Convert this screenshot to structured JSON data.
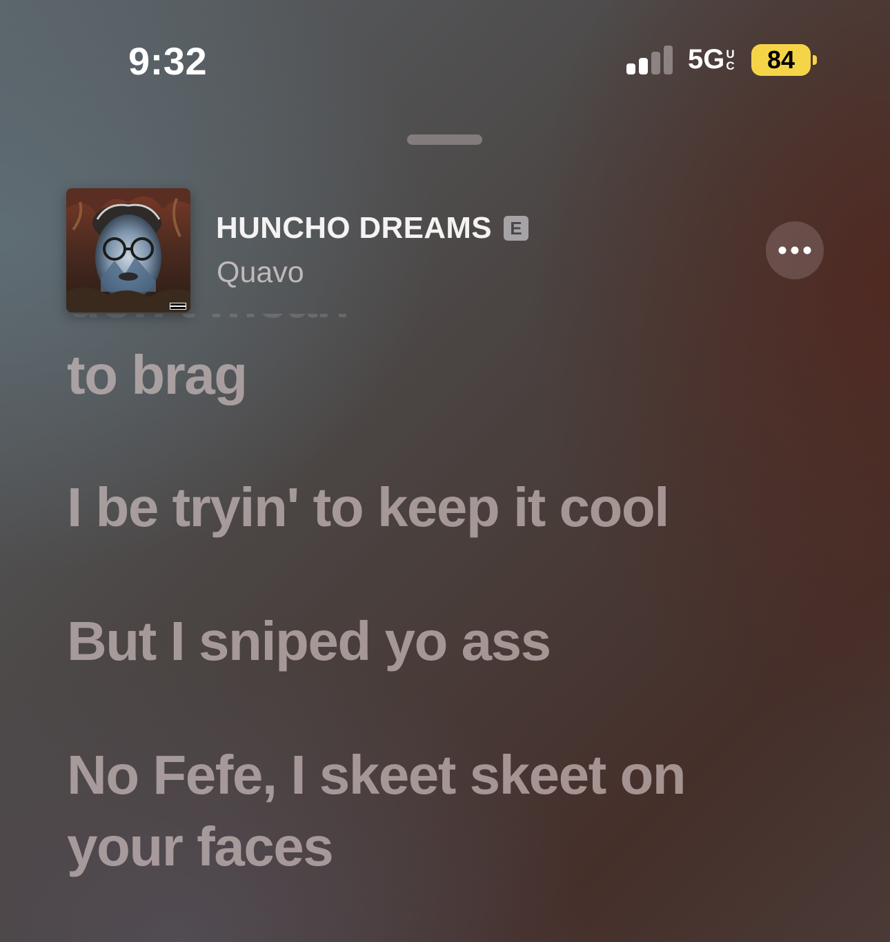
{
  "status_bar": {
    "time": "9:32",
    "network_label": "5G",
    "network_sub_top": "U",
    "network_sub_bottom": "C",
    "battery_level": "84",
    "battery_color": "#f5d547",
    "signal_bars_active": 2,
    "signal_bars_total": 4
  },
  "now_playing": {
    "title": "HUNCHO DREAMS",
    "explicit_badge": "E",
    "artist": "Quavo",
    "more_icon": "ellipsis-icon"
  },
  "lyrics": {
    "partial_line": "don't mean",
    "lines": [
      "to brag",
      "I be tryin' to keep it cool",
      "But I sniped yo ass",
      "No Fefe, I skeet skeet on",
      "your faces"
    ]
  }
}
